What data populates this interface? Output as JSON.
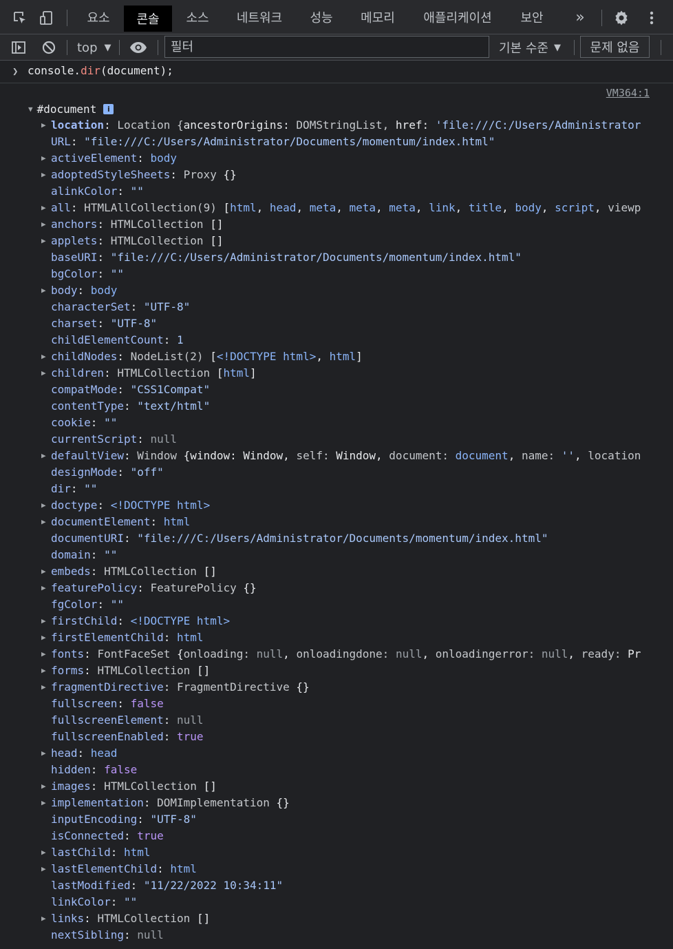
{
  "tabs": [
    "요소",
    "콘솔",
    "소스",
    "네트워크",
    "성능",
    "메모리",
    "애플리케이션",
    "보안"
  ],
  "more_tabs": "»",
  "toolbar": {
    "context": "top",
    "filter_placeholder": "필터",
    "levels": "기본 수준",
    "issues": "문제 없음"
  },
  "command": "console.dir(document);",
  "source_link": "VM364:1",
  "root_label": "#document",
  "info_badge": "i",
  "colors": {
    "background": "#202124",
    "toolbar": "#292a2d",
    "key": "#9fbbf8",
    "string": "#a8c7fa",
    "boolean": "#b995f7"
  },
  "props": [
    {
      "k": "location",
      "e": true,
      "bold": true,
      "v": [
        [
          "c",
          "Location {"
        ],
        [
          "p",
          "ancestorOrigins: "
        ],
        [
          "c",
          "DOMStringList, "
        ],
        [
          "p",
          "href: "
        ],
        [
          "s",
          "'file:///C:/Users/Administrator"
        ]
      ]
    },
    {
      "k": "URL",
      "e": false,
      "v": [
        [
          "s",
          "\"file:///C:/Users/Administrator/Documents/momentum/index.html\""
        ]
      ]
    },
    {
      "k": "activeElement",
      "e": true,
      "v": [
        [
          "t",
          "body"
        ]
      ]
    },
    {
      "k": "adoptedStyleSheets",
      "e": true,
      "v": [
        [
          "c",
          "Proxy "
        ],
        [
          "p",
          "{}"
        ]
      ]
    },
    {
      "k": "alinkColor",
      "e": false,
      "v": [
        [
          "s",
          "\"\""
        ]
      ]
    },
    {
      "k": "all",
      "e": true,
      "v": [
        [
          "c",
          "HTMLAllCollection(9) "
        ],
        [
          "p",
          "["
        ],
        [
          "t",
          "html"
        ],
        [
          "p",
          ", "
        ],
        [
          "t",
          "head"
        ],
        [
          "p",
          ", "
        ],
        [
          "t",
          "meta"
        ],
        [
          "p",
          ", "
        ],
        [
          "t",
          "meta"
        ],
        [
          "p",
          ", "
        ],
        [
          "t",
          "meta"
        ],
        [
          "p",
          ", "
        ],
        [
          "t",
          "link"
        ],
        [
          "p",
          ", "
        ],
        [
          "t",
          "title"
        ],
        [
          "p",
          ", "
        ],
        [
          "t",
          "body"
        ],
        [
          "p",
          ", "
        ],
        [
          "t",
          "script"
        ],
        [
          "p",
          ", "
        ],
        [
          "c",
          "viewp"
        ]
      ]
    },
    {
      "k": "anchors",
      "e": true,
      "v": [
        [
          "c",
          "HTMLCollection "
        ],
        [
          "p",
          "[]"
        ]
      ]
    },
    {
      "k": "applets",
      "e": true,
      "v": [
        [
          "c",
          "HTMLCollection "
        ],
        [
          "p",
          "[]"
        ]
      ]
    },
    {
      "k": "baseURI",
      "e": false,
      "v": [
        [
          "s",
          "\"file:///C:/Users/Administrator/Documents/momentum/index.html\""
        ]
      ]
    },
    {
      "k": "bgColor",
      "e": false,
      "v": [
        [
          "s",
          "\"\""
        ]
      ]
    },
    {
      "k": "body",
      "e": true,
      "v": [
        [
          "t",
          "body"
        ]
      ]
    },
    {
      "k": "characterSet",
      "e": false,
      "v": [
        [
          "s",
          "\"UTF-8\""
        ]
      ]
    },
    {
      "k": "charset",
      "e": false,
      "v": [
        [
          "s",
          "\"UTF-8\""
        ]
      ]
    },
    {
      "k": "childElementCount",
      "e": false,
      "v": [
        [
          "n",
          "1"
        ]
      ]
    },
    {
      "k": "childNodes",
      "e": true,
      "v": [
        [
          "c",
          "NodeList(2) "
        ],
        [
          "p",
          "["
        ],
        [
          "t",
          "<!DOCTYPE html>"
        ],
        [
          "p",
          ", "
        ],
        [
          "t",
          "html"
        ],
        [
          "p",
          "]"
        ]
      ]
    },
    {
      "k": "children",
      "e": true,
      "v": [
        [
          "c",
          "HTMLCollection "
        ],
        [
          "p",
          "["
        ],
        [
          "t",
          "html"
        ],
        [
          "p",
          "]"
        ]
      ]
    },
    {
      "k": "compatMode",
      "e": false,
      "v": [
        [
          "s",
          "\"CSS1Compat\""
        ]
      ]
    },
    {
      "k": "contentType",
      "e": false,
      "v": [
        [
          "s",
          "\"text/html\""
        ]
      ]
    },
    {
      "k": "cookie",
      "e": false,
      "v": [
        [
          "s",
          "\"\""
        ]
      ]
    },
    {
      "k": "currentScript",
      "e": false,
      "v": [
        [
          "nl",
          "null"
        ]
      ]
    },
    {
      "k": "defaultView",
      "e": true,
      "v": [
        [
          "c",
          "Window "
        ],
        [
          "p",
          "{window: "
        ],
        [
          "p",
          "Window, "
        ],
        [
          "c",
          "self: "
        ],
        [
          "p",
          "Window, "
        ],
        [
          "c",
          "document: "
        ],
        [
          "t",
          "document"
        ],
        [
          "p",
          ", "
        ],
        [
          "c",
          "name: "
        ],
        [
          "s",
          "''"
        ],
        [
          "p",
          ", "
        ],
        [
          "c",
          "location"
        ]
      ]
    },
    {
      "k": "designMode",
      "e": false,
      "v": [
        [
          "s",
          "\"off\""
        ]
      ]
    },
    {
      "k": "dir",
      "e": false,
      "v": [
        [
          "s",
          "\"\""
        ]
      ]
    },
    {
      "k": "doctype",
      "e": true,
      "v": [
        [
          "t",
          "<!DOCTYPE html>"
        ]
      ]
    },
    {
      "k": "documentElement",
      "e": true,
      "v": [
        [
          "t",
          "html"
        ]
      ]
    },
    {
      "k": "documentURI",
      "e": false,
      "v": [
        [
          "s",
          "\"file:///C:/Users/Administrator/Documents/momentum/index.html\""
        ]
      ]
    },
    {
      "k": "domain",
      "e": false,
      "v": [
        [
          "s",
          "\"\""
        ]
      ]
    },
    {
      "k": "embeds",
      "e": true,
      "v": [
        [
          "c",
          "HTMLCollection "
        ],
        [
          "p",
          "[]"
        ]
      ]
    },
    {
      "k": "featurePolicy",
      "e": true,
      "v": [
        [
          "c",
          "FeaturePolicy "
        ],
        [
          "p",
          "{}"
        ]
      ]
    },
    {
      "k": "fgColor",
      "e": false,
      "v": [
        [
          "s",
          "\"\""
        ]
      ]
    },
    {
      "k": "firstChild",
      "e": true,
      "v": [
        [
          "t",
          "<!DOCTYPE html>"
        ]
      ]
    },
    {
      "k": "firstElementChild",
      "e": true,
      "v": [
        [
          "t",
          "html"
        ]
      ]
    },
    {
      "k": "fonts",
      "e": true,
      "v": [
        [
          "c",
          "FontFaceSet "
        ],
        [
          "p",
          "{"
        ],
        [
          "c",
          "onloading: "
        ],
        [
          "nl",
          "null"
        ],
        [
          "p",
          ", "
        ],
        [
          "c",
          "onloadingdone: "
        ],
        [
          "nl",
          "null"
        ],
        [
          "p",
          ", "
        ],
        [
          "c",
          "onloadingerror: "
        ],
        [
          "nl",
          "null"
        ],
        [
          "p",
          ", "
        ],
        [
          "c",
          "ready: "
        ],
        [
          "p",
          "Pr"
        ]
      ]
    },
    {
      "k": "forms",
      "e": true,
      "v": [
        [
          "c",
          "HTMLCollection "
        ],
        [
          "p",
          "[]"
        ]
      ]
    },
    {
      "k": "fragmentDirective",
      "e": true,
      "v": [
        [
          "c",
          "FragmentDirective "
        ],
        [
          "p",
          "{}"
        ]
      ]
    },
    {
      "k": "fullscreen",
      "e": false,
      "v": [
        [
          "b",
          "false"
        ]
      ]
    },
    {
      "k": "fullscreenElement",
      "e": false,
      "v": [
        [
          "nl",
          "null"
        ]
      ]
    },
    {
      "k": "fullscreenEnabled",
      "e": false,
      "v": [
        [
          "b",
          "true"
        ]
      ]
    },
    {
      "k": "head",
      "e": true,
      "v": [
        [
          "t",
          "head"
        ]
      ]
    },
    {
      "k": "hidden",
      "e": false,
      "v": [
        [
          "b",
          "false"
        ]
      ]
    },
    {
      "k": "images",
      "e": true,
      "v": [
        [
          "c",
          "HTMLCollection "
        ],
        [
          "p",
          "[]"
        ]
      ]
    },
    {
      "k": "implementation",
      "e": true,
      "v": [
        [
          "c",
          "DOMImplementation "
        ],
        [
          "p",
          "{}"
        ]
      ]
    },
    {
      "k": "inputEncoding",
      "e": false,
      "v": [
        [
          "s",
          "\"UTF-8\""
        ]
      ]
    },
    {
      "k": "isConnected",
      "e": false,
      "v": [
        [
          "b",
          "true"
        ]
      ]
    },
    {
      "k": "lastChild",
      "e": true,
      "v": [
        [
          "t",
          "html"
        ]
      ]
    },
    {
      "k": "lastElementChild",
      "e": true,
      "v": [
        [
          "t",
          "html"
        ]
      ]
    },
    {
      "k": "lastModified",
      "e": false,
      "v": [
        [
          "s",
          "\"11/22/2022 10:34:11\""
        ]
      ]
    },
    {
      "k": "linkColor",
      "e": false,
      "v": [
        [
          "s",
          "\"\""
        ]
      ]
    },
    {
      "k": "links",
      "e": true,
      "v": [
        [
          "c",
          "HTMLCollection "
        ],
        [
          "p",
          "[]"
        ]
      ]
    },
    {
      "k": "nextSibling",
      "e": false,
      "v": [
        [
          "nl",
          "null"
        ]
      ]
    }
  ]
}
